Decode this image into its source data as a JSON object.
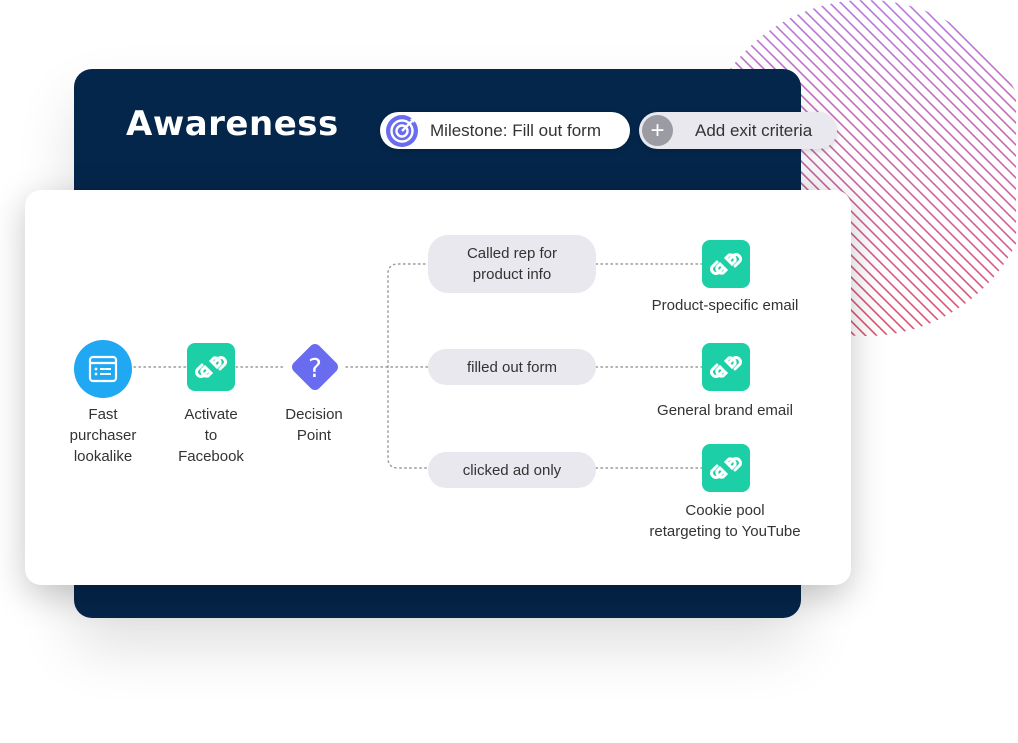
{
  "header": {
    "title": "Awareness",
    "milestone_label": "Milestone: Fill out form",
    "exit_label": "Add exit criteria"
  },
  "flow": {
    "start": "Fast\npurchaser\nlookalike",
    "activate": "Activate\nto\nFacebook",
    "decision": "Decision\nPoint",
    "decision_symbol": "?",
    "branches": [
      {
        "condition": "Called rep for\nproduct info",
        "action": "Product-specific email"
      },
      {
        "condition": "filled out form",
        "action": "General brand email"
      },
      {
        "condition": "clicked ad only",
        "action": "Cookie pool\nretargeting to YouTube"
      }
    ]
  },
  "colors": {
    "dark_bg": "#04264a",
    "teal": "#1ccfa6",
    "blue": "#21a8f2",
    "purple": "#6a6cf0",
    "pill_gray": "#e8e8ee"
  },
  "icons": {
    "milestone": "target-icon",
    "exit": "plus-icon",
    "start": "list-window-icon",
    "action": "link-icon",
    "decision": "question-diamond-icon"
  }
}
